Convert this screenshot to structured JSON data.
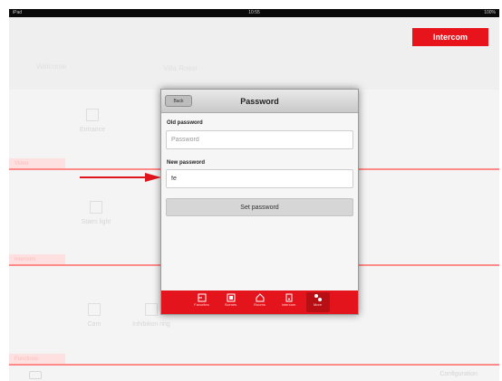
{
  "statusbar": {
    "carrier": "iPad",
    "time": "10:55",
    "battery": "100%"
  },
  "header": {
    "brand_button": "Intercom",
    "faint_line1": "Welcome",
    "faint_line2": "Villa Rossi"
  },
  "background": {
    "sections": [
      "Video",
      "Intercom",
      "Functions"
    ],
    "items": [
      "Entrance",
      "Stairs light",
      "Cam",
      "Inhibition ring"
    ],
    "footer_text": "Configuration"
  },
  "modal": {
    "back_label": "Back",
    "title": "Password",
    "old_password": {
      "label": "Old password",
      "placeholder": "Password",
      "value": ""
    },
    "new_password": {
      "label": "New password",
      "placeholder": "",
      "value": "fe"
    },
    "set_button": "Set password"
  },
  "toolbar": {
    "accent": "#e3141c",
    "items": [
      {
        "label": "Favorites",
        "icon": "favorites-icon"
      },
      {
        "label": "Scenes",
        "icon": "scenes-icon"
      },
      {
        "label": "Rooms",
        "icon": "rooms-icon"
      },
      {
        "label": "Intercom",
        "icon": "intercom-icon"
      },
      {
        "label": "More",
        "icon": "more-icon"
      }
    ],
    "active_index": 4
  }
}
